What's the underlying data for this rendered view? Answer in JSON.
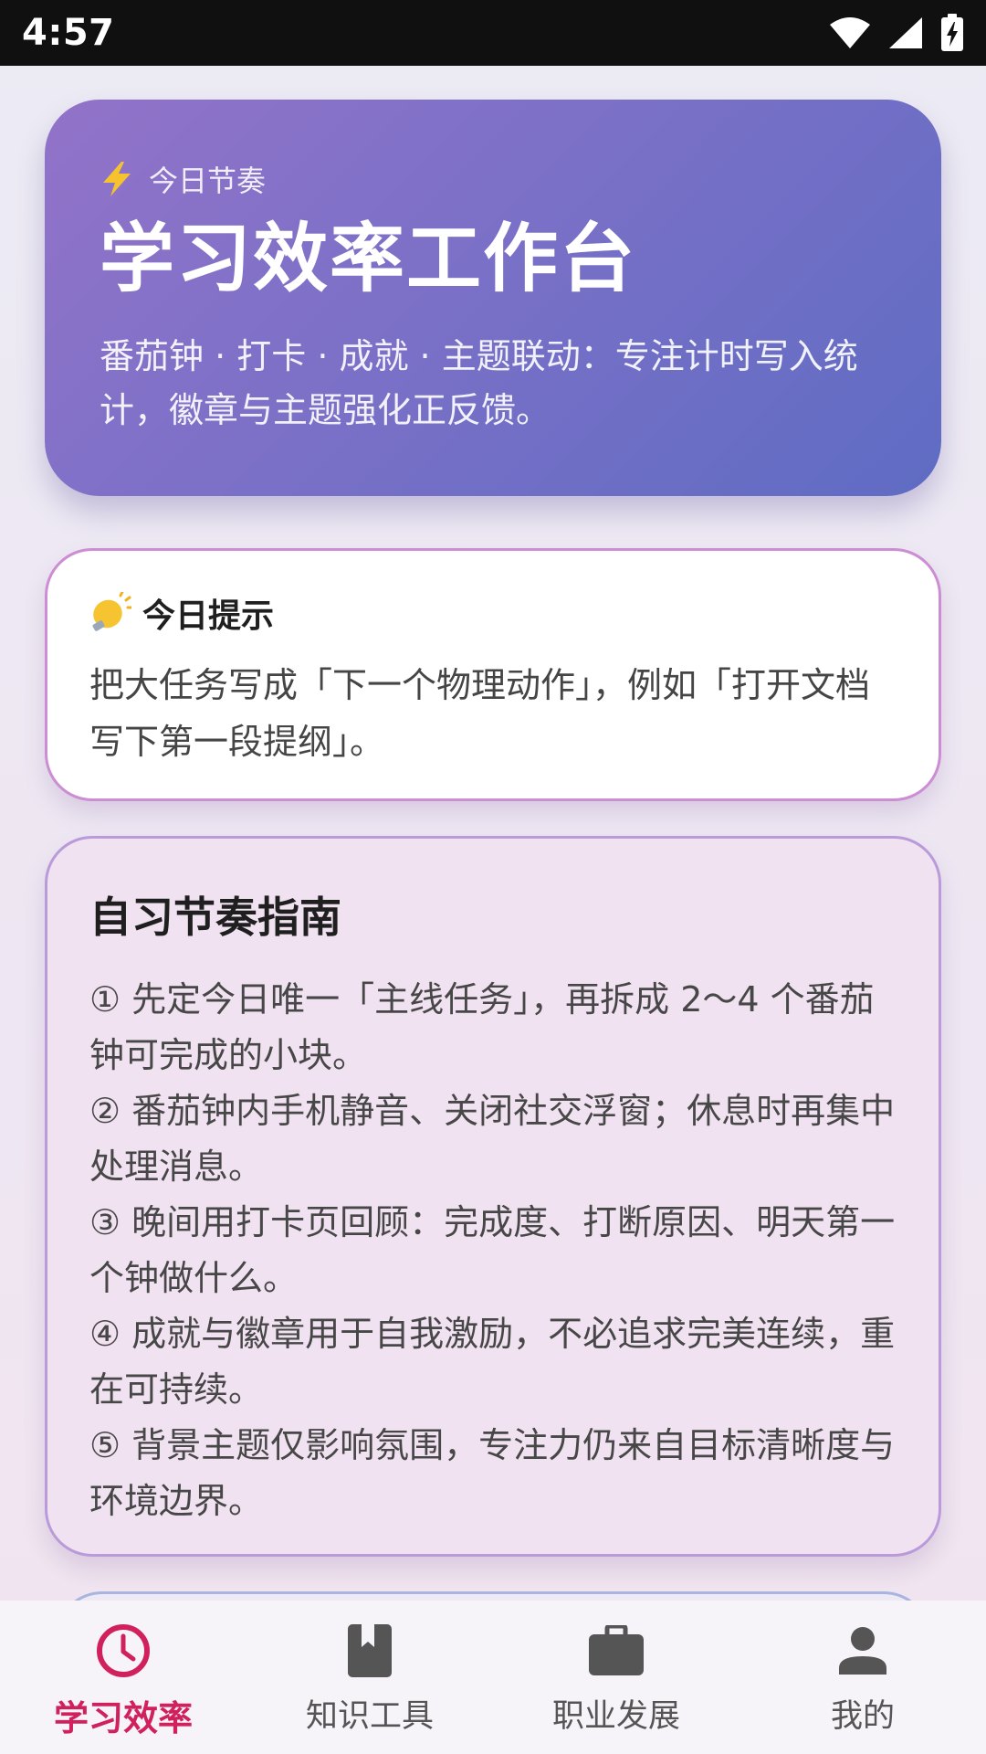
{
  "status_bar": {
    "time": "4:57"
  },
  "hero": {
    "eyebrow": "今日节奏",
    "title": "学习效率工作台",
    "description": "番茄钟 · 打卡 · 成就 · 主题联动：专注计时写入统计，徽章与主题强化正反馈。"
  },
  "tip": {
    "title": "今日提示",
    "text": "把大任务写成「下一个物理动作」，例如「打开文档写下第一段提纲」。"
  },
  "guide": {
    "title": "自习节奏指南",
    "items": [
      "① 先定今日唯一「主线任务」，再拆成 2～4 个番茄钟可完成的小块。",
      "② 番茄钟内手机静音、关闭社交浮窗；休息时再集中处理消息。",
      "③ 晚间用打卡页回顾：完成度、打断原因、明天第一个钟做什么。",
      "④ 成就与徽章用于自我激励，不必追求完美连续，重在可持续。",
      "⑤ 背景主题仅影响氛围，专注力仍来自目标清晰度与环境边界。"
    ]
  },
  "nav": {
    "items": [
      {
        "label": "学习效率",
        "icon": "clock-icon",
        "active": true
      },
      {
        "label": "知识工具",
        "icon": "book-icon",
        "active": false
      },
      {
        "label": "职业发展",
        "icon": "briefcase-icon",
        "active": false
      },
      {
        "label": "我的",
        "icon": "person-icon",
        "active": false
      }
    ],
    "active_color": "#D0215C",
    "inactive_color": "#555555"
  }
}
